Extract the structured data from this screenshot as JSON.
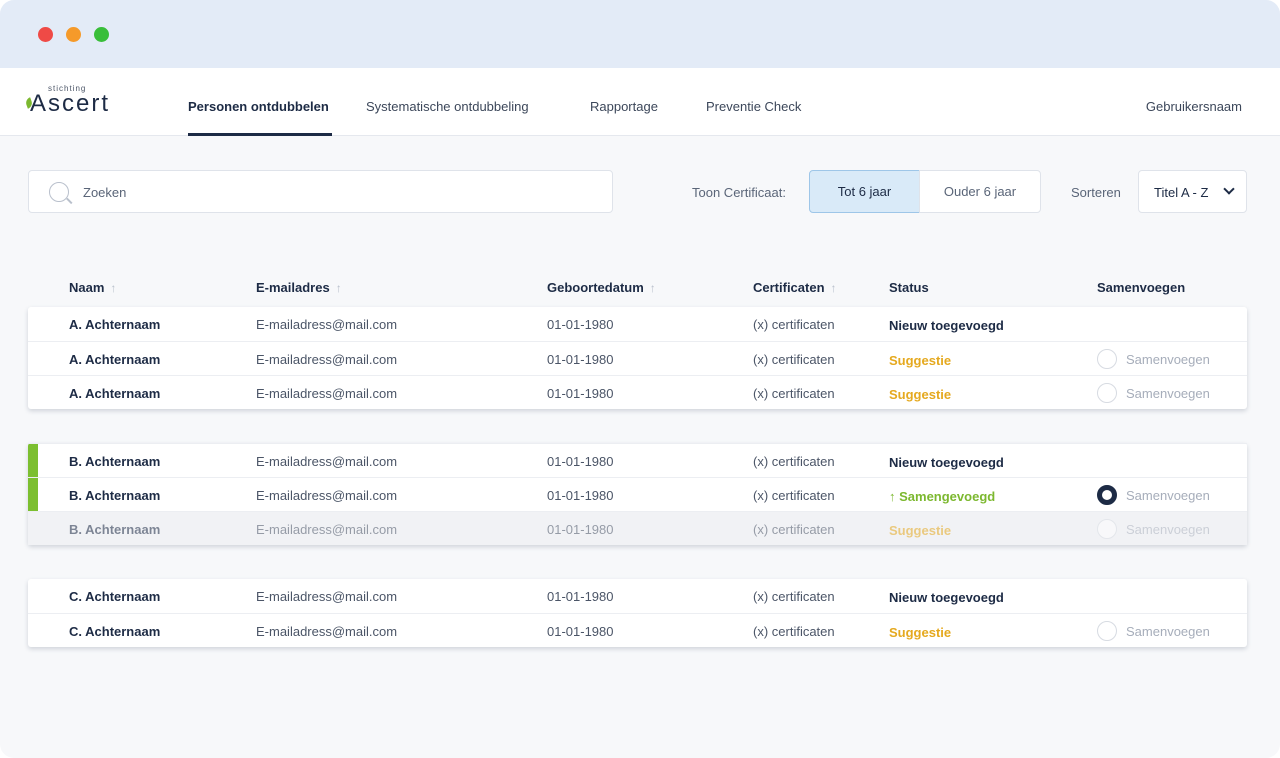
{
  "logo": {
    "small": "stichting",
    "main": "Ascert"
  },
  "nav": {
    "items": [
      "Personen ontdubbelen",
      "Systematische ontdubbeling",
      "Rapportage",
      "Preventie Check"
    ],
    "user": "Gebruikersnaam"
  },
  "search": {
    "placeholder": "Zoeken"
  },
  "filter": {
    "label": "Toon Certificaat:",
    "option_1": "Tot 6 jaar",
    "option_2": "Ouder 6 jaar"
  },
  "sort": {
    "label": "Sorteren",
    "value": "Titel A - Z"
  },
  "table": {
    "headers": [
      "Naam",
      "E-mailadres",
      "Geboortedatum",
      "Certificaten",
      "Status",
      "Samenvoegen"
    ],
    "sort_arrow": "↑",
    "merge_label": "Samenvoegen",
    "groups": [
      {
        "rows": [
          {
            "name": "A. Achternaam",
            "email": "E-mailadress@mail.com",
            "dob": "01-01-1980",
            "cert": "(x) certificaten",
            "status": "Nieuw toegevoegd"
          },
          {
            "name": "A. Achternaam",
            "email": "E-mailadress@mail.com",
            "dob": "01-01-1980",
            "cert": "(x) certificaten",
            "status": "Suggestie"
          },
          {
            "name": "A. Achternaam",
            "email": "E-mailadress@mail.com",
            "dob": "01-01-1980",
            "cert": "(x) certificaten",
            "status": "Suggestie"
          }
        ]
      },
      {
        "rows": [
          {
            "name": "B. Achternaam",
            "email": "E-mailadress@mail.com",
            "dob": "01-01-1980",
            "cert": "(x) certificaten",
            "status": "Nieuw toegevoegd"
          },
          {
            "name": "B. Achternaam",
            "email": "E-mailadress@mail.com",
            "dob": "01-01-1980",
            "cert": "(x) certificaten",
            "status": "↑ Samengevoegd"
          },
          {
            "name": "B. Achternaam",
            "email": "E-mailadress@mail.com",
            "dob": "01-01-1980",
            "cert": "(x) certificaten",
            "status": "Suggestie"
          }
        ]
      },
      {
        "rows": [
          {
            "name": "C. Achternaam",
            "email": "E-mailadress@mail.com",
            "dob": "01-01-1980",
            "cert": "(x) certificaten",
            "status": "Nieuw toegevoegd"
          },
          {
            "name": "C. Achternaam",
            "email": "E-mailadress@mail.com",
            "dob": "01-01-1980",
            "cert": "(x) certificaten",
            "status": "Suggestie"
          }
        ]
      }
    ]
  },
  "colors": {
    "accent_green": "#7cbf30",
    "suggestion": "#e5a91f",
    "navy": "#1d2b45",
    "selected_bg": "#d9eaf8"
  }
}
